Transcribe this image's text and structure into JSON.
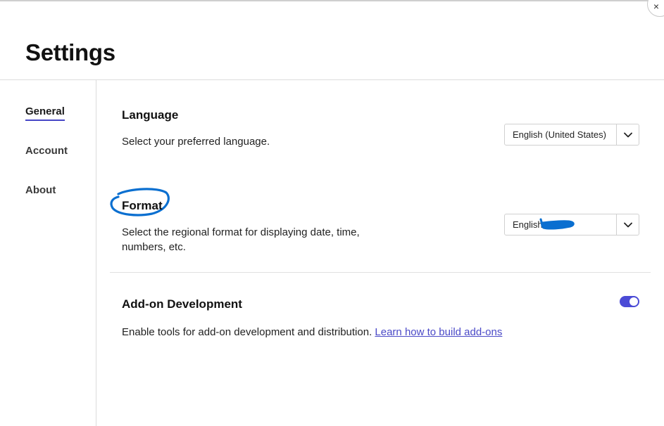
{
  "title": "Settings",
  "close_label": "×",
  "nav": {
    "items": [
      {
        "label": "General",
        "active": true
      },
      {
        "label": "Account",
        "active": false
      },
      {
        "label": "About",
        "active": false
      }
    ]
  },
  "language": {
    "title": "Language",
    "description": "Select your preferred language.",
    "selected": "English (United States)"
  },
  "format": {
    "title": "Format",
    "description_line1": "Select the regional format for displaying date, time,",
    "description_line2": "numbers, etc.",
    "selected": "English"
  },
  "addon": {
    "title": "Add-on Development",
    "description": "Enable tools for add-on development and distribution.",
    "link_text": "Learn how to build add-ons",
    "enabled": true
  },
  "colors": {
    "accent": "#4b4bd6",
    "link": "#4a49c7",
    "annotation": "#0a6fd0"
  },
  "icons": {
    "dropdown": "chevron-down-icon",
    "close": "close-icon"
  }
}
